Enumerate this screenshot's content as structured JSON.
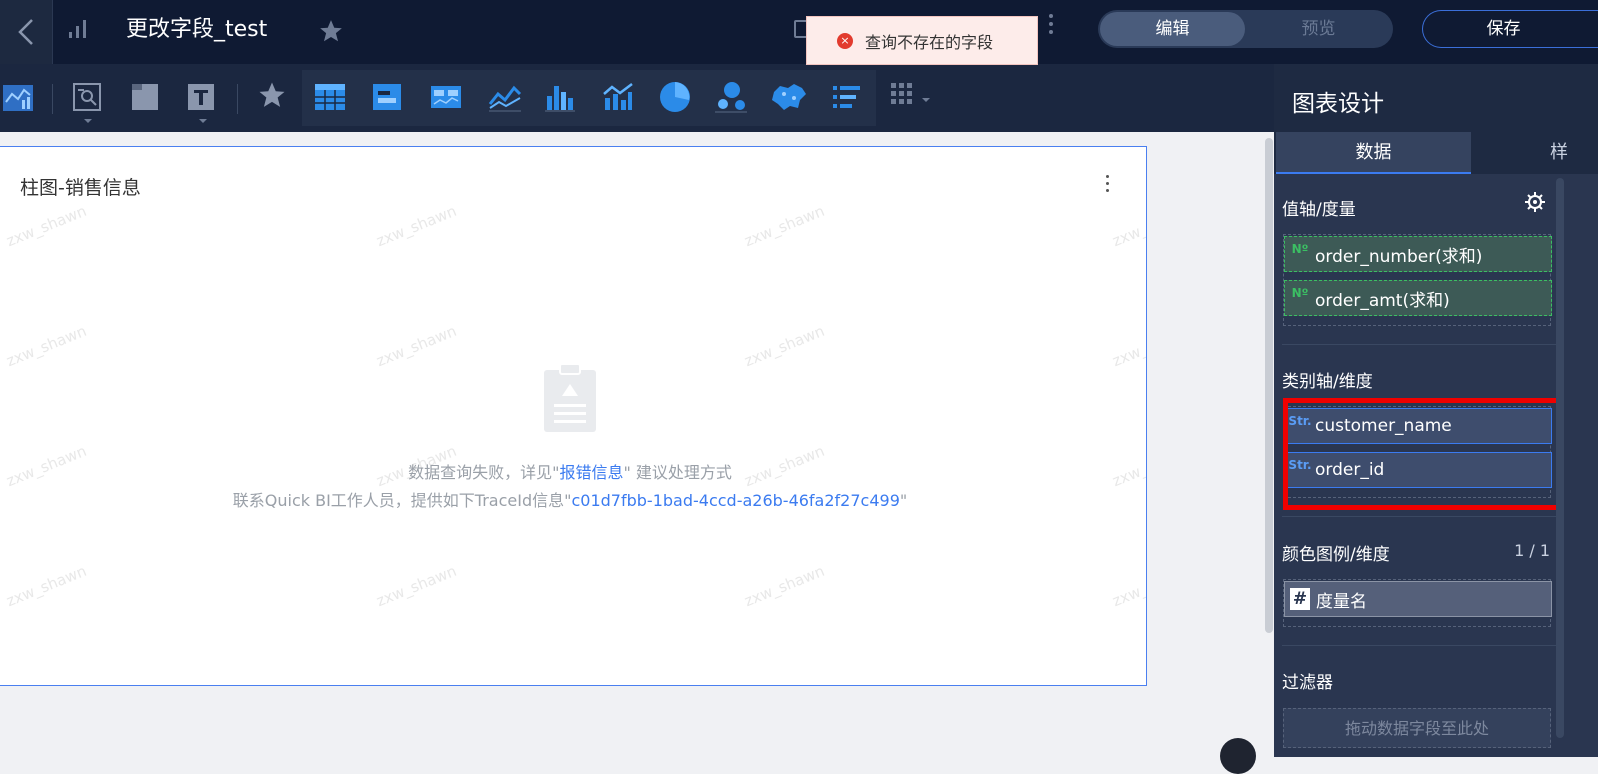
{
  "header": {
    "title": "更改字段_test",
    "mode_edit": "编辑",
    "mode_preview": "预览",
    "save_label": "保存",
    "toast": "查询不存在的字段"
  },
  "toolbar": {
    "tools": [
      "dashboard-icon",
      "query-control-icon",
      "tab-icon",
      "text-icon",
      "favorite-icon"
    ],
    "chart_types": [
      "table-icon",
      "kpi-card-icon",
      "indicator-icon",
      "line-chart-icon",
      "bar-chart-icon",
      "combo-chart-icon",
      "pie-chart-icon",
      "scatter-icon",
      "map-icon",
      "rank-list-icon",
      "more-charts-icon"
    ]
  },
  "card": {
    "title": "柱图-销售信息",
    "watermark": "zxw_shawn",
    "error_prefix": "数据查询失败，详见\"",
    "error_link": "报错信息",
    "error_suffix": "\" 建议处理方式",
    "trace_prefix": "联系Quick BI工作人员，提供如下TraceId信息\"",
    "trace_id": "c01d7fbb-1bad-4ccd-a26b-46fa2f27c499",
    "trace_suffix": "\""
  },
  "panel": {
    "title": "图表设计",
    "tab_data": "数据",
    "tab_style": "样",
    "value_axis": {
      "label": "值轴/度量",
      "fields": [
        {
          "tag": "Nº",
          "name": "order_number(求和)"
        },
        {
          "tag": "Nº",
          "name": "order_amt(求和)"
        }
      ]
    },
    "category_axis": {
      "label": "类别轴/维度",
      "fields": [
        {
          "tag": "Str.",
          "name": "customer_name"
        },
        {
          "tag": "Str.",
          "name": "order_id"
        }
      ]
    },
    "color_legend": {
      "label": "颜色图例/维度",
      "count": "1 / 1",
      "field": {
        "tag": "#",
        "name": "度量名"
      }
    },
    "filter": {
      "label": "过滤器",
      "placeholder": "拖动数据字段至此处"
    }
  },
  "colors": {
    "topbar_bg": "#0f1a33",
    "panel_bg": "#2a3650",
    "accent_blue": "#3b7bf0",
    "highlight_red": "#f00000",
    "measure_green": "#3bbf63"
  }
}
